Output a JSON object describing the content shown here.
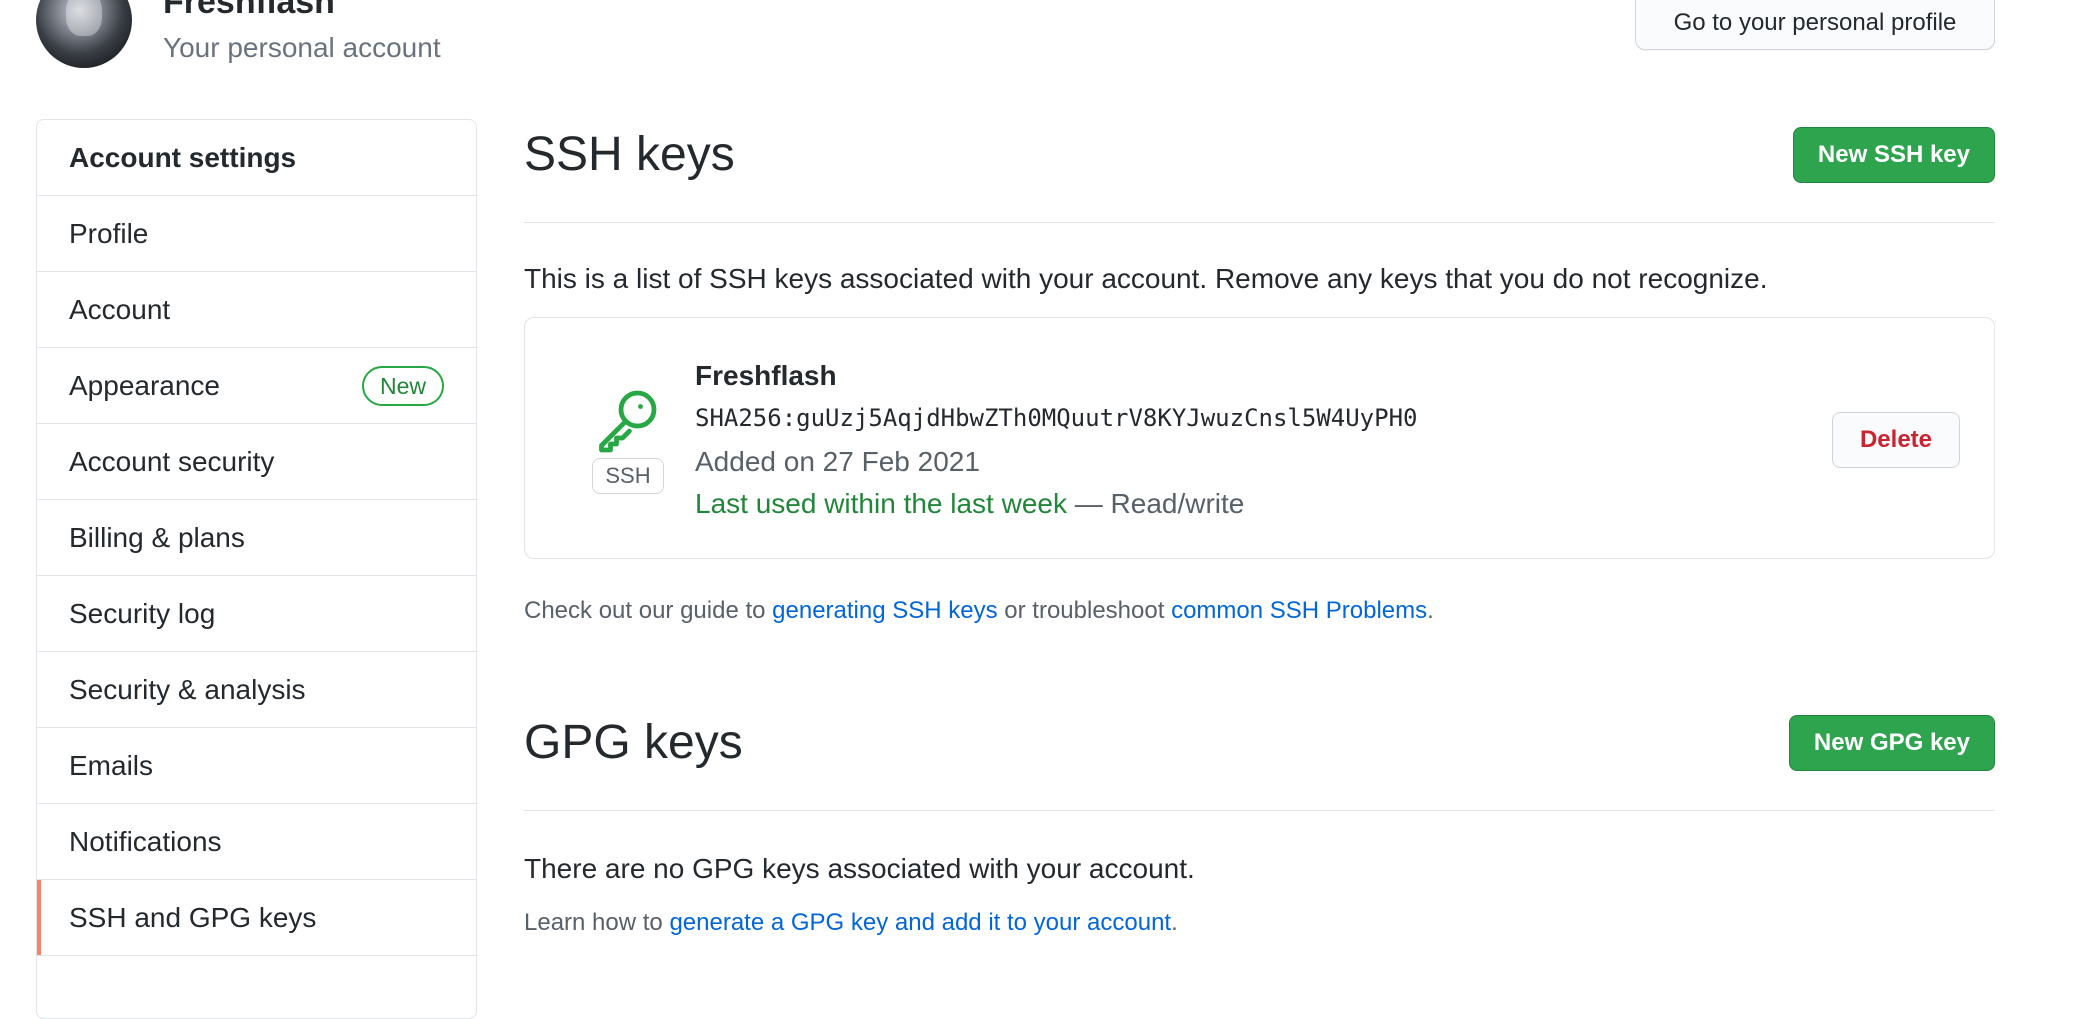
{
  "header": {
    "username": "Freshflash",
    "account_type": "Your personal account",
    "profile_button": "Go to your personal profile"
  },
  "sidebar": {
    "title": "Account settings",
    "items": [
      {
        "label": "Profile"
      },
      {
        "label": "Account"
      },
      {
        "label": "Appearance",
        "badge": "New"
      },
      {
        "label": "Account security"
      },
      {
        "label": "Billing & plans"
      },
      {
        "label": "Security log"
      },
      {
        "label": "Security & analysis"
      },
      {
        "label": "Emails"
      },
      {
        "label": "Notifications"
      },
      {
        "label": "SSH and GPG keys",
        "selected": true
      }
    ]
  },
  "ssh": {
    "title": "SSH keys",
    "new_button": "New SSH key",
    "description": "This is a list of SSH keys associated with your account. Remove any keys that you do not recognize.",
    "key": {
      "badge": "SSH",
      "title": "Freshflash",
      "fingerprint": "SHA256:guUzj5AqjdHbwZTh0MQuutrV8KYJwuzCnsl5W4UyPH0",
      "added": "Added on 27 Feb 2021",
      "last_used": "Last used within the last week",
      "access": " — Read/write",
      "delete_button": "Delete"
    },
    "guide": {
      "prefix": "Check out our guide to ",
      "link1": "generating SSH keys",
      "middle": " or troubleshoot ",
      "link2": "common SSH Problems",
      "suffix": "."
    }
  },
  "gpg": {
    "title": "GPG keys",
    "new_button": "New GPG key",
    "description": "There are no GPG keys associated with your account.",
    "learn": {
      "prefix": "Learn how to ",
      "link": "generate a GPG key and add it to your account",
      "suffix": "."
    }
  },
  "colors": {
    "primary_green": "#2ea44f",
    "link_blue": "#0366d6",
    "danger_red": "#cb2431",
    "selected_accent": "#f9826c"
  },
  "icons": {
    "key": "key-icon"
  }
}
